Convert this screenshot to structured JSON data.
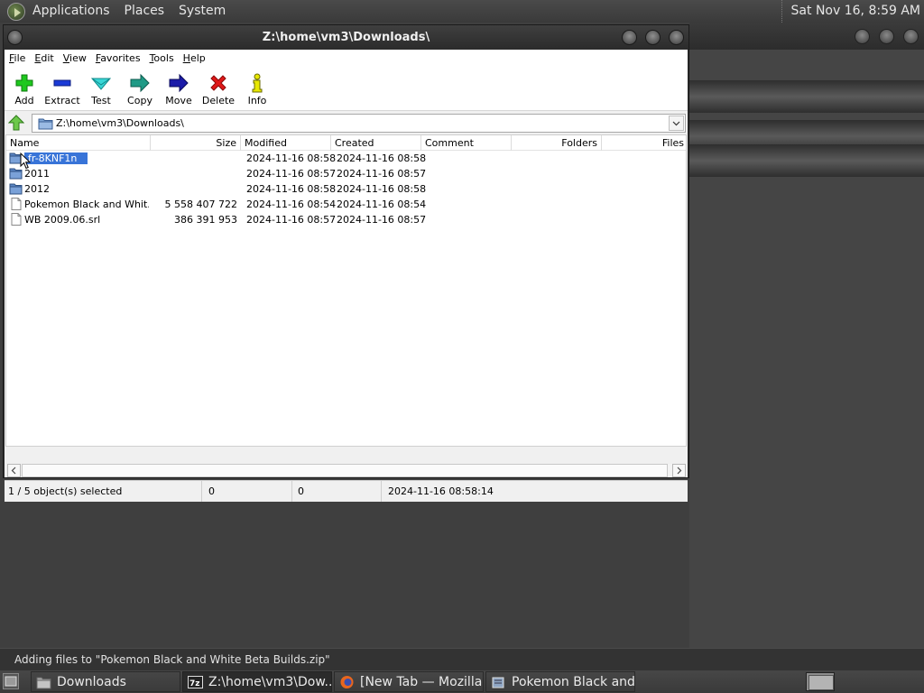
{
  "top_panel": {
    "menus": [
      "Applications",
      "Places",
      "System"
    ],
    "clock": "Sat Nov 16,  8:59 AM"
  },
  "window": {
    "title": "Z:\\home\\vm3\\Downloads\\",
    "menu": [
      "File",
      "Edit",
      "View",
      "Favorites",
      "Tools",
      "Help"
    ],
    "toolbar": [
      {
        "label": "Add",
        "icon": "plus-icon"
      },
      {
        "label": "Extract",
        "icon": "minus-icon"
      },
      {
        "label": "Test",
        "icon": "check-icon"
      },
      {
        "label": "Copy",
        "icon": "copy-arrow-icon"
      },
      {
        "label": "Move",
        "icon": "move-arrow-icon"
      },
      {
        "label": "Delete",
        "icon": "x-icon"
      },
      {
        "label": "Info",
        "icon": "info-icon"
      }
    ],
    "address": "Z:\\home\\vm3\\Downloads\\",
    "columns": [
      "Name",
      "Size",
      "Modified",
      "Created",
      "Comment",
      "Folders",
      "Files"
    ],
    "rows": [
      {
        "name": "fr-8KNF1n",
        "size": "",
        "modified": "2024-11-16 08:58",
        "created": "2024-11-16 08:58",
        "type": "folder",
        "selected": true
      },
      {
        "name": "2011",
        "size": "",
        "modified": "2024-11-16 08:57",
        "created": "2024-11-16 08:57",
        "type": "folder"
      },
      {
        "name": "2012",
        "size": "",
        "modified": "2024-11-16 08:58",
        "created": "2024-11-16 08:58",
        "type": "folder"
      },
      {
        "name": "Pokemon Black and Whit...",
        "size": "5 558 407 722",
        "modified": "2024-11-16 08:54",
        "created": "2024-11-16 08:54",
        "type": "file"
      },
      {
        "name": "WB 2009.06.srl",
        "size": "386 391 953",
        "modified": "2024-11-16 08:57",
        "created": "2024-11-16 08:57",
        "type": "file"
      }
    ],
    "status": {
      "selection": "1 / 5 object(s) selected",
      "size": "0",
      "packed": "0",
      "datetime": "2024-11-16 08:58:14"
    }
  },
  "notification": "Adding files to \"Pokemon Black and White Beta Builds.zip\"",
  "taskbar": {
    "tasks": [
      {
        "label": "Downloads",
        "icon": "folder-icon"
      },
      {
        "label": "Z:\\home\\vm3\\Dow...",
        "icon": "7zip-icon",
        "active": true
      },
      {
        "label": "[New Tab — Mozilla...",
        "icon": "firefox-icon"
      },
      {
        "label": "Pokemon Black and ...",
        "icon": "archive-window-icon"
      }
    ]
  }
}
